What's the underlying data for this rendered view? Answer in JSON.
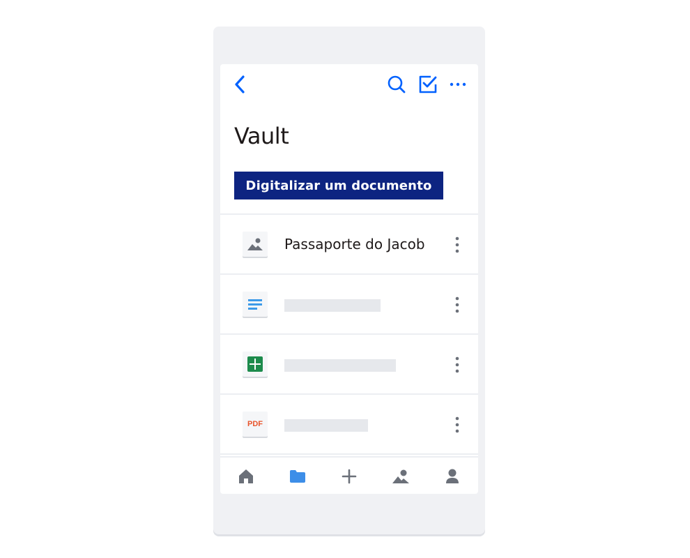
{
  "header": {
    "title": "Vault",
    "icons": [
      "chevron-left-icon",
      "search-icon",
      "checkbox-icon",
      "more-horizontal-icon"
    ]
  },
  "actions": {
    "scan_label": "Digitalizar um documento"
  },
  "files": [
    {
      "name": "Passaporte do Jacob",
      "type": "image"
    },
    {
      "name": "",
      "type": "document"
    },
    {
      "name": "",
      "type": "spreadsheet"
    },
    {
      "name": "",
      "type": "pdf",
      "badge": "PDF"
    }
  ],
  "bottom_nav": [
    "home",
    "files",
    "add",
    "photos",
    "account"
  ],
  "colors": {
    "accent": "#0061fe",
    "button_bg": "#0d2481",
    "icon_gray": "#6b7079",
    "doc_blue": "#3d9ae8",
    "sheet_green": "#1d8b4c",
    "pdf_red": "#e8552c"
  }
}
